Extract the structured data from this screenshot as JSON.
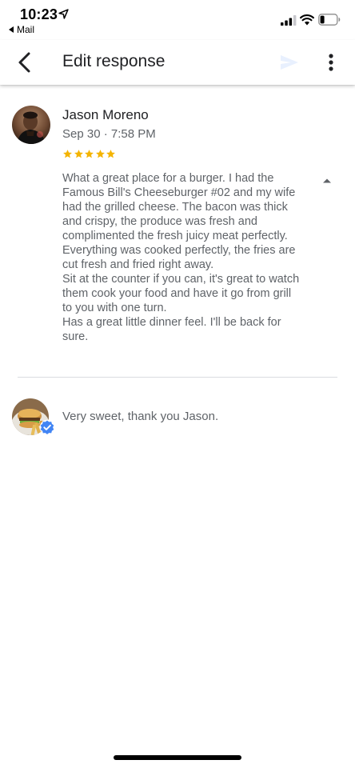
{
  "status_bar": {
    "time": "10:23",
    "back_label": "Mail",
    "icons": [
      "location-icon",
      "signal-icon",
      "wifi-icon",
      "battery-icon"
    ]
  },
  "app_bar": {
    "title": "Edit response",
    "icons": [
      "back-arrow-icon",
      "send-icon",
      "more-vert-icon"
    ]
  },
  "review": {
    "author": "Jason Moreno",
    "date": "Sep 30 · 7:58 PM",
    "rating": 5,
    "rating_max": 5,
    "text": "What a great place for a burger. I had the Famous Bill's Cheeseburger #02 and my wife had the grilled cheese. The bacon was thick and crispy, the produce was fresh and complimented the fresh juicy meat perfectly.\nEverything was cooked perfectly, the fries are cut fresh and fried right away.\nSit at the counter if you can, it's great to watch them cook your food and have it go from grill to you with one turn.\nHas a great little dinner feel. I'll be back for sure."
  },
  "response": {
    "text": "Very sweet, thank you Jason."
  },
  "colors": {
    "star": "#f4b400",
    "verified": "#4285f4",
    "send_disabled": "#e8f0fe",
    "secondary_text": "#5f6368",
    "primary_text": "#202124"
  }
}
